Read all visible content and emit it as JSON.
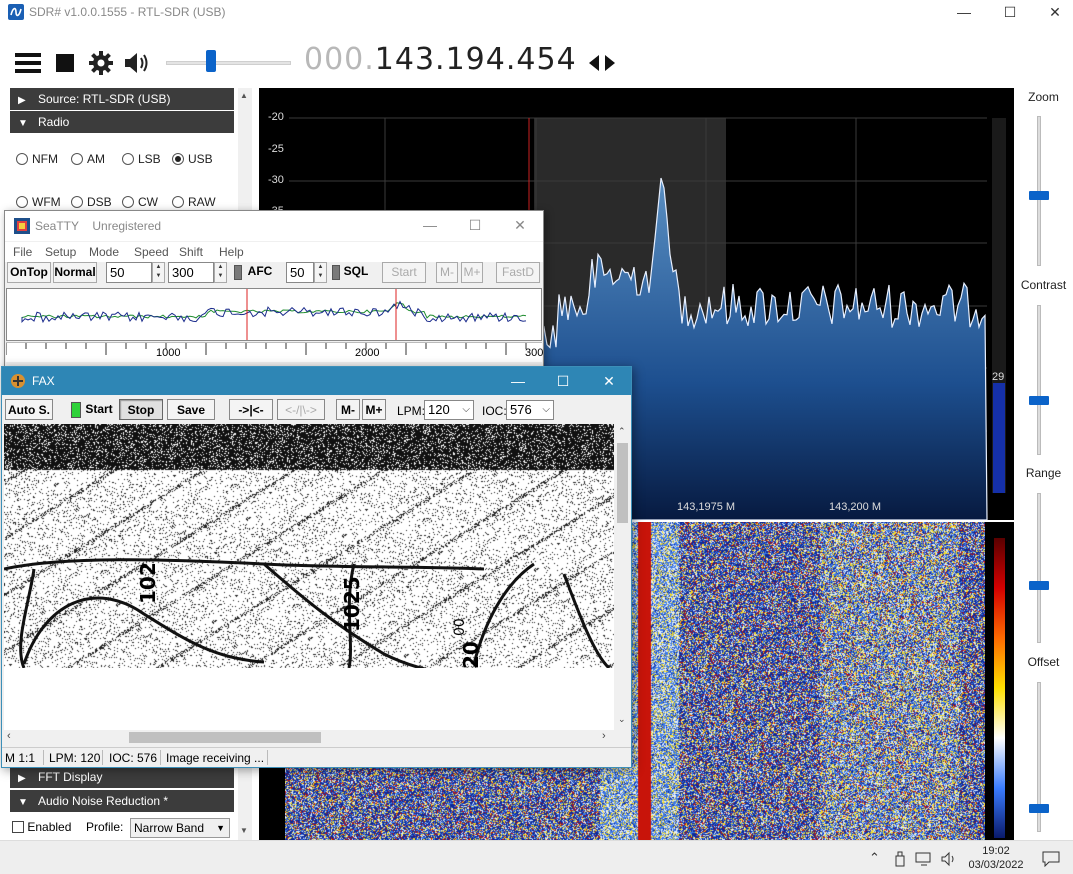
{
  "sdr": {
    "title": "SDR# v1.0.0.1555 - RTL-SDR (USB)",
    "frequency_dim": "000.",
    "frequency_main": "143.194.454",
    "volume_level": 0.36,
    "left_panel": {
      "source_header": "Source: RTL-SDR (USB)",
      "radio_header": "Radio",
      "modes": [
        {
          "label": "NFM",
          "selected": false
        },
        {
          "label": "AM",
          "selected": false
        },
        {
          "label": "LSB",
          "selected": false
        },
        {
          "label": "USB",
          "selected": true
        },
        {
          "label": "WFM",
          "selected": false
        },
        {
          "label": "DSB",
          "selected": false
        },
        {
          "label": "CW",
          "selected": false
        },
        {
          "label": "RAW",
          "selected": false
        }
      ],
      "fft_header": "FFT Display",
      "anr_header": "Audio Noise Reduction *",
      "enabled_label": "Enabled",
      "profile_label": "Profile:",
      "profile_value": "Narrow Band"
    },
    "spectrum": {
      "y_ticks": [
        "-20",
        "-25",
        "-30",
        "-35"
      ],
      "x_ticks": [
        "143,1975 M",
        "143,200 M"
      ],
      "level_value": "29"
    },
    "right_panel": {
      "zoom_label": "Zoom",
      "contrast_label": "Contrast",
      "range_label": "Range",
      "offset_label": "Offset"
    }
  },
  "seatty": {
    "title": "SeaTTY",
    "subtitle": "Unregistered",
    "menu": [
      "File",
      "Setup",
      "Mode",
      "Speed",
      "Shift",
      "Help"
    ],
    "toolbar": {
      "ontop": "OnTop",
      "normal": "Normal",
      "baud": "50",
      "shift": "300",
      "afc": "AFC",
      "sql_level": "50",
      "sql": "SQL",
      "start": "Start",
      "m_minus": "M-",
      "m_plus": "M+",
      "fastd": "FastD"
    },
    "scale_labels": [
      "1000",
      "2000",
      "300"
    ]
  },
  "fax": {
    "title": "FAX",
    "toolbar": {
      "auto": "Auto S.",
      "start": "Start",
      "stop": "Stop",
      "save": "Save",
      "shift_left": "->|<-",
      "shift_right": "<-/|\\->",
      "m_minus": "M-",
      "m_plus": "M+",
      "lpm_label": "LPM:",
      "lpm_value": "120",
      "ioc_label": "IOC:",
      "ioc_value": "576"
    },
    "image_labels": [
      "102",
      "1025",
      "20",
      "00"
    ],
    "status": {
      "zoom": "M 1:1",
      "lpm": "LPM: 120",
      "ioc": "IOC: 576",
      "message": "Image receiving ..."
    }
  },
  "taskbar": {
    "time": "19:02",
    "date": "03/03/2022"
  },
  "colors": {
    "accent": "#0b63c9",
    "fax_title": "#2e86b5",
    "spectrum_fill": "#4a7fb3"
  }
}
